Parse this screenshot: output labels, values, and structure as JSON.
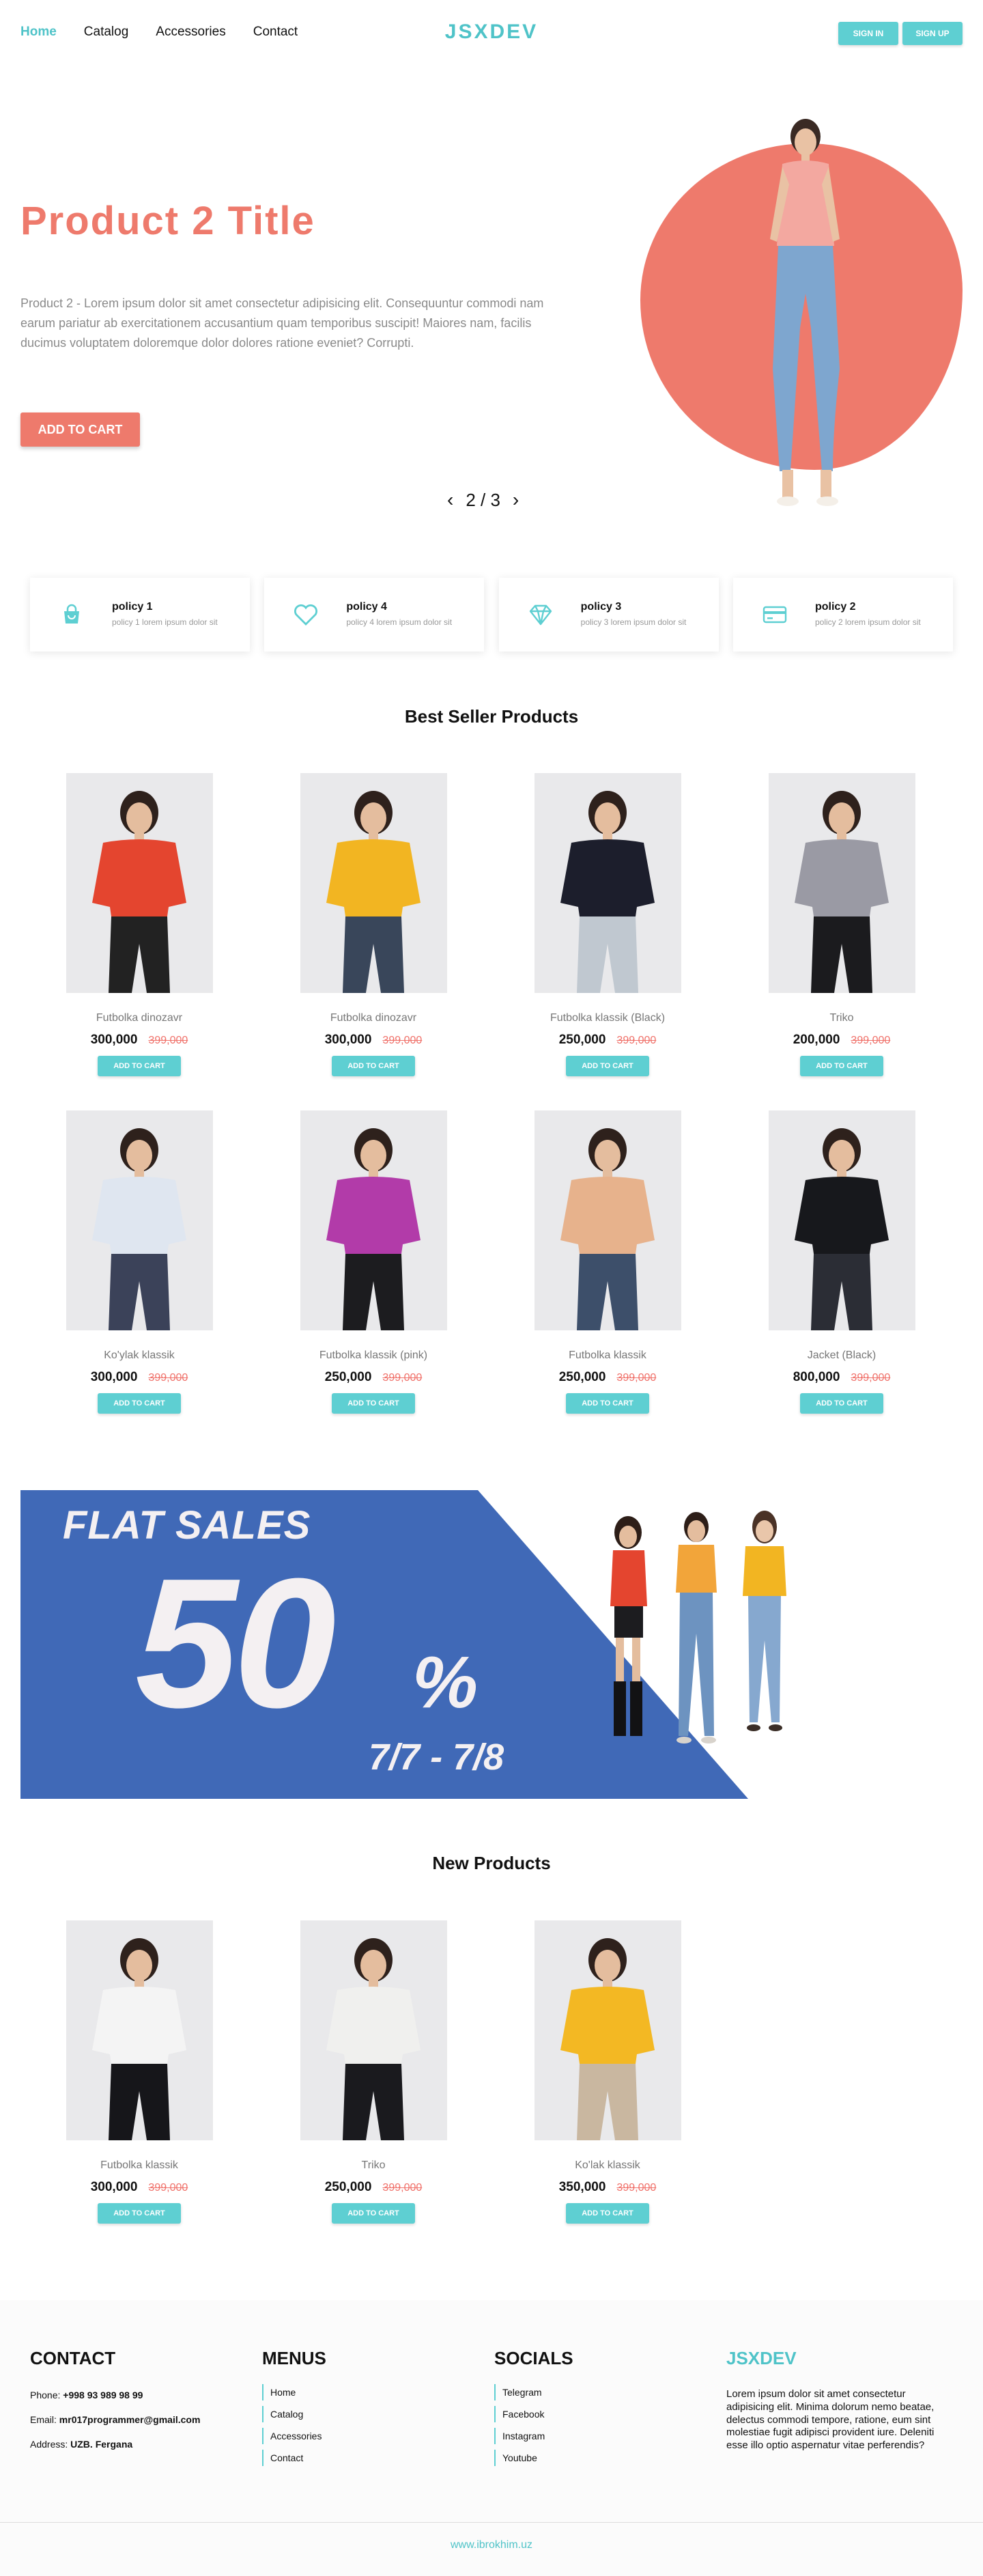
{
  "nav": {
    "items": [
      {
        "label": "Home",
        "active": true
      },
      {
        "label": "Catalog",
        "active": false
      },
      {
        "label": "Accessories",
        "active": false
      },
      {
        "label": "Contact",
        "active": false
      }
    ],
    "logo": "JSXDEV",
    "sign_in": "SIGN IN",
    "sign_up": "SIGN UP"
  },
  "hero": {
    "title": "Product 2 Title",
    "description": "Product 2 - Lorem ipsum dolor sit amet consectetur adipisicing elit. Consequuntur commodi nam earum pariatur ab exercitationem accusantium quam temporibus suscipit! Maiores nam, facilis ducimus voluptatem doloremque dolor dolores ratione eveniet? Corrupti.",
    "button": "ADD TO CART",
    "pager": "2 / 3",
    "prev_icon": "chevron-left-icon",
    "next_icon": "chevron-right-icon"
  },
  "policies": [
    {
      "title": "policy 1",
      "sub": "policy 1 lorem ipsum dolor sit",
      "icon": "shopping-bag-icon"
    },
    {
      "title": "policy 4",
      "sub": "policy 4 lorem ipsum dolor sit",
      "icon": "heart-icon"
    },
    {
      "title": "policy 3",
      "sub": "policy 3 lorem ipsum dolor sit",
      "icon": "diamond-icon"
    },
    {
      "title": "policy 2",
      "sub": "policy 2 lorem ipsum dolor sit",
      "icon": "credit-card-icon"
    }
  ],
  "best_seller": {
    "title": "Best Seller Products",
    "products": [
      {
        "name": "Futbolka dinozavr",
        "price": "300,000",
        "old": "399,000",
        "button": "ADD TO CART",
        "shirt": "#e4452f",
        "pants": "#222222"
      },
      {
        "name": "Futbolka dinozavr",
        "price": "300,000",
        "old": "399,000",
        "button": "ADD TO CART",
        "shirt": "#f2b522",
        "pants": "#39465a"
      },
      {
        "name": "Futbolka klassik (Black)",
        "price": "250,000",
        "old": "399,000",
        "button": "ADD TO CART",
        "shirt": "#1c1e2c",
        "pants": "#c0c8d0"
      },
      {
        "name": "Triko",
        "price": "200,000",
        "old": "399,000",
        "button": "ADD TO CART",
        "shirt": "#9a9aa4",
        "pants": "#1b1b1e"
      },
      {
        "name": "Ko'ylak klassik",
        "price": "300,000",
        "old": "399,000",
        "button": "ADD TO CART",
        "shirt": "#dfe6f0",
        "pants": "#3b4259"
      },
      {
        "name": "Futbolka klassik (pink)",
        "price": "250,000",
        "old": "399,000",
        "button": "ADD TO CART",
        "shirt": "#b23ba9",
        "pants": "#1c1c1f"
      },
      {
        "name": "Futbolka klassik",
        "price": "250,000",
        "old": "399,000",
        "button": "ADD TO CART",
        "shirt": "#e7b28c",
        "pants": "#3d4f6a"
      },
      {
        "name": "Jacket (Black)",
        "price": "800,000",
        "old": "399,000",
        "button": "ADD TO CART",
        "shirt": "#17181c",
        "pants": "#2b2d35"
      }
    ]
  },
  "banner": {
    "line1": "FLAT SALES",
    "big": "50",
    "pct": "%",
    "dates": "7/7 - 7/8",
    "color": "#4069b7"
  },
  "new_products": {
    "title": "New Products",
    "products": [
      {
        "name": "Futbolka klassik",
        "price": "300,000",
        "old": "399,000",
        "button": "ADD TO CART",
        "shirt": "#f4f4f4",
        "pants": "#16161a"
      },
      {
        "name": "Triko",
        "price": "250,000",
        "old": "399,000",
        "button": "ADD TO CART",
        "shirt": "#f0f0ee",
        "pants": "#1a1a1e"
      },
      {
        "name": "Ko'lak klassik",
        "price": "350,000",
        "old": "399,000",
        "button": "ADD TO CART",
        "shirt": "#f3b823",
        "pants": "#c9b7a0"
      }
    ]
  },
  "footer": {
    "contact": {
      "title": "CONTACT",
      "phone_label": "Phone:",
      "phone": "+998 93 989 98 99",
      "email_label": "Email:",
      "email": "mr017programmer@gmail.com",
      "address_label": "Address:",
      "address": "UZB. Fergana"
    },
    "menus": {
      "title": "MENUS",
      "items": [
        "Home",
        "Catalog",
        "Accessories",
        "Contact"
      ]
    },
    "socials": {
      "title": "SOCIALS",
      "items": [
        "Telegram",
        "Facebook",
        "Instagram",
        "Youtube"
      ]
    },
    "brand": {
      "title": "JSXDEV",
      "text": "Lorem ipsum dolor sit amet consectetur adipisicing elit. Minima dolorum nemo beatae, delectus commodi tempore, ratione, eum sint molestiae fugit adipisci provident iure. Deleniti esse illo optio aspernatur vitae perferendis?"
    },
    "credit": "www.ibrokhim.uz"
  },
  "colors": {
    "accent": "#5ecfd2",
    "coral": "#ee7a6c",
    "banner_blue": "#4069b7"
  }
}
